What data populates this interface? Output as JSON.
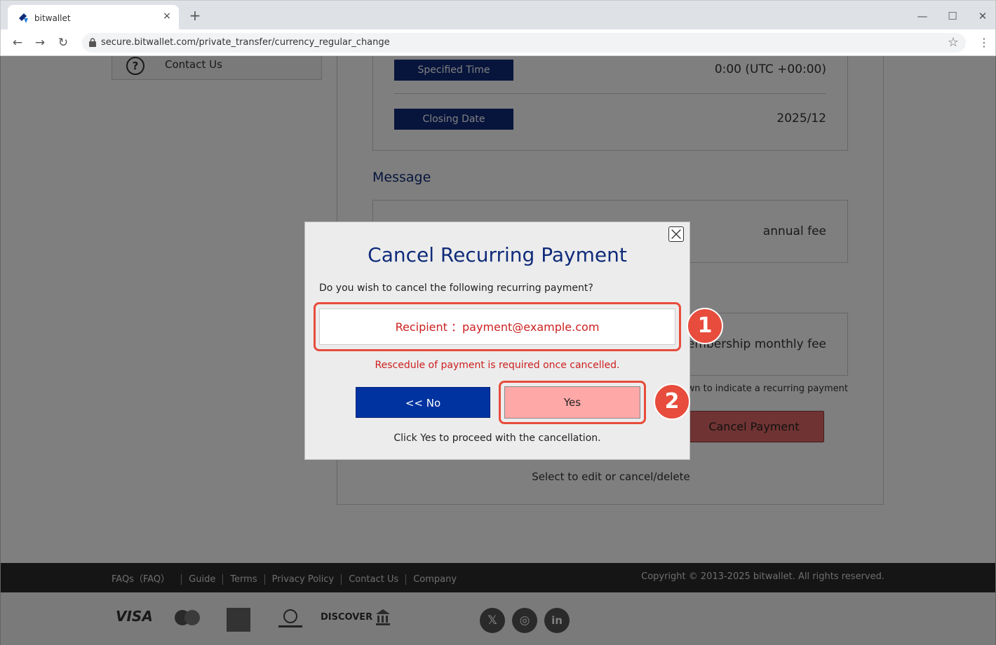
{
  "browser": {
    "tab_title": "bitwallet",
    "tab_close": "×",
    "new_tab": "+",
    "url": "secure.bitwallet.com/private_transfer/currency_regular_change",
    "win_min": "—",
    "win_max": "☐",
    "win_close": "✕"
  },
  "sidebar": {
    "contact_label": "Contact Us"
  },
  "details": {
    "specified_time_label": "Specified Time",
    "specified_time_value": "0:00 (UTC +00:00)",
    "closing_date_label": "Closing Date",
    "closing_date_value": "2025/12",
    "message_title": "Message",
    "message_value": "annual fee",
    "memo_value": "membership monthly fee",
    "note": "shown to indicate a recurring payment",
    "cancel_payment_label": "Cancel Payment",
    "select_hint": "Select to edit or cancel/delete"
  },
  "footer": {
    "links": [
      "FAQs（FAQ）",
      "Guide",
      "Terms",
      "Privacy Policy",
      "Contact Us",
      "Company"
    ],
    "copyright": "Copyright © 2013-2025 bitwallet. All rights reserved.",
    "payment_logos": [
      "VISA",
      "DISCOVER"
    ]
  },
  "modal": {
    "title": "Cancel Recurring Payment",
    "question": "Do you wish to cancel the following recurring payment?",
    "recipient": "Recipient ：payment@example.com",
    "warning": "Rescedule of payment is required once cancelled.",
    "no_label": "<< No",
    "yes_label": "Yes",
    "proceed": "Click Yes to proceed with the cancellation.",
    "badge_1": "1",
    "badge_2": "2"
  },
  "colors": {
    "brand_navy": "#0f2b7a",
    "no_button": "#0033a0",
    "yes_button": "#ffa8a8",
    "annotation_red": "#e74c3c",
    "warning_red": "#cc1f1f"
  }
}
